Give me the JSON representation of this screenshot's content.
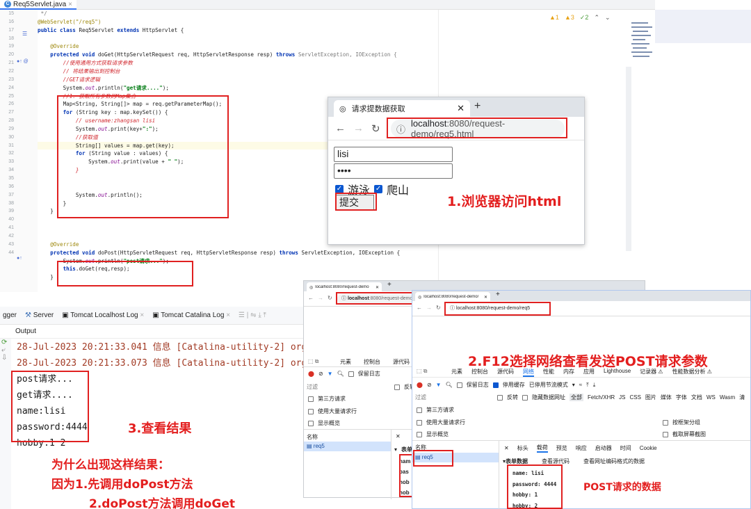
{
  "editor": {
    "file_tab": "Req5Servlet.java",
    "inspections": {
      "warn1": "1",
      "warn3": "3",
      "ok2": "2"
    },
    "line_numbers": [
      "15",
      "16",
      "17",
      "18",
      "19",
      "20",
      "21",
      "22",
      "23",
      "24",
      "25",
      "26",
      "27",
      "28",
      "29",
      "30",
      "31",
      "32",
      "33",
      "34",
      "35",
      "36",
      "37",
      "38",
      "39",
      "40",
      "41",
      "42",
      "43",
      "44"
    ],
    "code": {
      "l15": " */",
      "l16a": "@WebServlet(\"/req5\")",
      "l17a": "public class ",
      "l17b": "Req5Servlet ",
      "l17c": "extends ",
      "l17d": "HttpServlet {",
      "l19": "    @Override",
      "l20a": "    protected void ",
      "l20b": "doGet(HttpServletRequest req, HttpServletResponse resp) ",
      "l20c": "throws ",
      "l20d": "ServletException, IOException {",
      "l21": "        //使用通用方式获取请求参数",
      "l22": "        // 将结果输出到控制台",
      "l23": "        //GET请求逻辑",
      "l24a": "        System.",
      "l24b": "out",
      "l24c": ".println(",
      "l24d": "\"get请求....\"",
      "l24e": ");",
      "l25": "        //1. 获取所有参数的Map集合",
      "l26": "        Map<String, String[]> map = req.getParameterMap();",
      "l27a": "        for ",
      "l27b": "(String key : map.keySet()) {",
      "l28": "            // username:zhangsan lisi",
      "l29a": "            System.",
      "l29b": "out",
      "l29c": ".print(key+",
      "l29d": "\":\"",
      "l29e": ");",
      "l30": "            //获取值",
      "l31": "            String[] values = map.get(key);",
      "l32a": "            for ",
      "l32b": "(String value : values) {",
      "l33a": "                System.",
      "l33b": "out",
      "l33c": ".print(value + ",
      "l33d": "\" \"",
      "l33e": ");",
      "l34": "            }",
      "l36a": "            System.",
      "l36b": "out",
      "l36c": ".println();",
      "l37": "        }",
      "l38": "    }",
      "l40": "    @Override",
      "l41a": "    protected void ",
      "l41b": "doPost(HttpServletRequest req, HttpServletResponse resp) ",
      "l41c": "throws ",
      "l41d": "ServletException, IOException {",
      "l42a": "        System.",
      "l42b": "out",
      "l42c": ".println(",
      "l42d": "\"post请求...\"",
      "l42e": ");",
      "l43a": "        this",
      "l43b": ".doGet(req,resp);",
      "l44": "    }"
    }
  },
  "browser1": {
    "tab_title": "请求提数据获取",
    "url_host": "localhost",
    "url_path": ":8080/request-demo/req5.html",
    "username_value": "lisi",
    "password_value": "••••",
    "hobby1": "游泳",
    "hobby2": "爬山",
    "submit_label": "提交"
  },
  "annotations": {
    "a1": "1.浏览器访问html",
    "a2": "2.F12选择网络查看发送POST请求参数",
    "a3": "3.查看结果",
    "why1": "为什么出现这样结果：",
    "why2": "因为1.先调用doPost方法",
    "why3": "2.doPost方法调用doGet",
    "post_data": "POST请求的数据"
  },
  "console": {
    "tabs": [
      "gger",
      "Server",
      "Tomcat Localhost Log",
      "Tomcat Catalina Log"
    ],
    "output_label": "Output",
    "log1": "28-Jul-2023 20:21:33.041 信息 [Catalina-utility-2] org.ap",
    "log2": "28-Jul-2023 20:21:33.073 信息 [Catalina-utility-2] org.ap",
    "results": [
      "post请求...",
      "get请求....",
      "name:lisi",
      "password:4444",
      "hobby:1 2"
    ]
  },
  "browser2": {
    "tab_title": "localhost:8080/request-demo",
    "url_host": "localhost",
    "url_path": ":8080/request-demo",
    "devtools_tabs": [
      "元素",
      "控制台",
      "源代码"
    ],
    "preserve_log": "保留日志",
    "filter_placeholder": "过滤",
    "invert": "反转",
    "third_party": "第三方请求",
    "big_rows": "使用大量请求行",
    "overview": "显示概览",
    "name_header": "名称",
    "request_name": "req5",
    "form_data_short": "表单",
    "trunc_rows": [
      "nam",
      "pas",
      "hob",
      "hob"
    ]
  },
  "browser3": {
    "tab_title": "localhost:8080/request-demo/",
    "url": "localhost:8080/request-demo/req5",
    "devtools_tabs": [
      "元素",
      "控制台",
      "源代码",
      "网络",
      "性能",
      "内存",
      "应用",
      "Lighthouse",
      "记录器 ⚠",
      "性能数据分析 ⚠"
    ],
    "preserve_log": "保留日志",
    "disable_cache": "停用缓存",
    "throttle": "已停用节流模式",
    "filter_placeholder": "过滤",
    "invert": "反转",
    "hide_data_urls": "隐藏数据网址",
    "all": "全部",
    "types": [
      "Fetch/XHR",
      "JS",
      "CSS",
      "图片",
      "媒体",
      "字体",
      "文档",
      "WS",
      "Wasm",
      "清"
    ],
    "third_party": "第三方请求",
    "big_rows": "使用大量请求行",
    "overview": "显示概览",
    "group_by_frame": "按框架分组",
    "screenshot": "截取屏幕截图",
    "name_header": "名称",
    "detail_tabs": [
      "标头",
      "载荷",
      "预览",
      "响应",
      "启动器",
      "时间",
      "Cookie"
    ],
    "request_name": "req5",
    "form_data": "表单数据",
    "view_source": "查看源代码",
    "view_url_encoded": "查看网址编码格式的数据",
    "fields": [
      "name: lisi",
      "password: 4444",
      "hobby: 1",
      "hobby: 2"
    ]
  }
}
